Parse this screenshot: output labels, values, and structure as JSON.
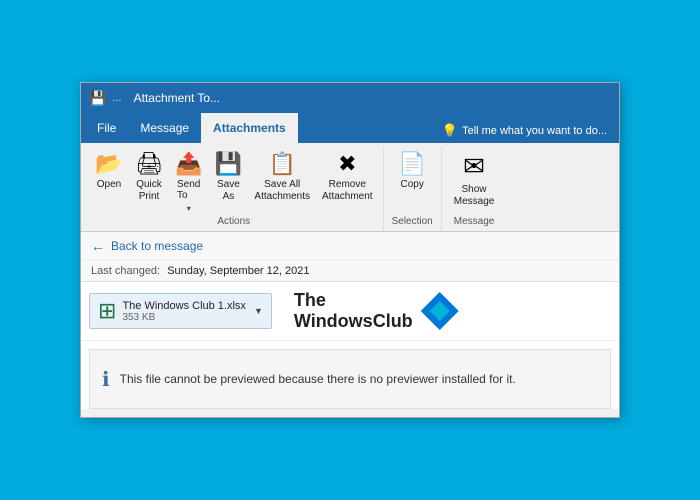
{
  "titleBar": {
    "title": "Attachment To...",
    "dots": "..."
  },
  "tabs": {
    "file": "File",
    "message": "Message",
    "attachments": "Attachments",
    "tellMe": "Tell me what you want to do..."
  },
  "ribbonGroups": {
    "actions": {
      "label": "Actions",
      "buttons": {
        "open": "Open",
        "quickPrint": "Quick Print",
        "sendTo": "Send To",
        "saveAs": "Save As",
        "saveAll": "Save All Attachments",
        "removeAttachment": "Remove Attachment"
      }
    },
    "selection": {
      "label": "Selection",
      "copy": "Copy"
    },
    "message": {
      "label": "Message",
      "showMessage": "Show Message"
    }
  },
  "backBar": {
    "arrow": "←",
    "label": "Back to message"
  },
  "lastChanged": {
    "label": "Last changed:",
    "date": "Sunday, September 12, 2021"
  },
  "attachment": {
    "fileName": "The Windows Club 1.xlsx",
    "fileSize": "353 KB",
    "dropdownArrow": "▼"
  },
  "windowsClub": {
    "line1": "The",
    "line2": "WindowsClub"
  },
  "preview": {
    "message": "This file cannot be previewed because there is no previewer installed for it."
  }
}
